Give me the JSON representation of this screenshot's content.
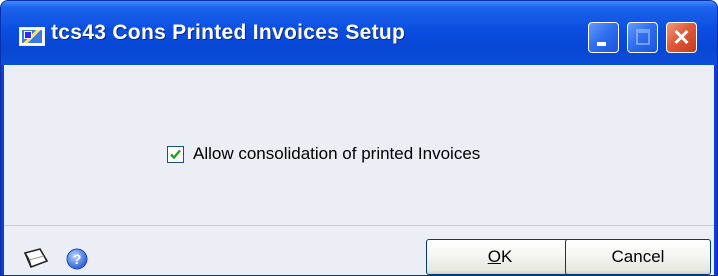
{
  "window": {
    "title": "tcs43 Cons Printed Invoices Setup",
    "icon": "app-window-icon",
    "controls": [
      "minimize-icon",
      "maximize-icon",
      "close-icon"
    ],
    "close_glyph": "✕"
  },
  "options": {
    "allow_consolidation": {
      "label": "Allow consolidation of printed Invoices",
      "checked": true
    }
  },
  "footer": {
    "icons": [
      "note-icon",
      "help-icon"
    ],
    "ok_mnemonic": "O",
    "ok_rest": "K",
    "cancel_label": "Cancel"
  },
  "colors": {
    "titlebar": "#0a4ee0",
    "client_bg": "#ebeef4",
    "close_button": "#e05a3a"
  }
}
